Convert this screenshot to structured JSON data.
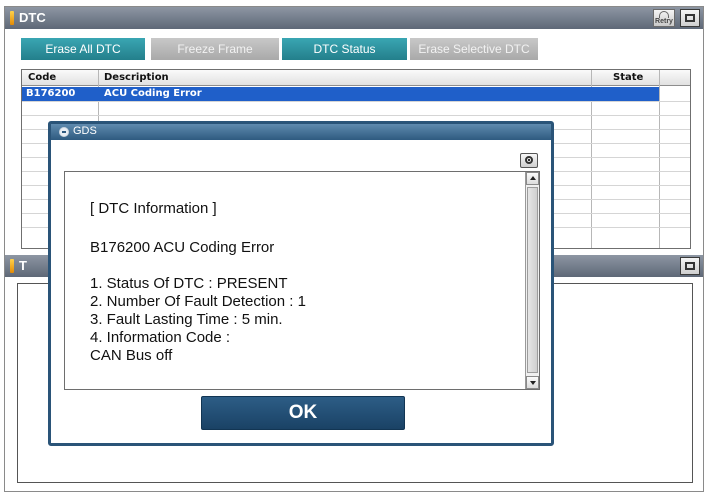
{
  "window": {
    "title": "DTC",
    "retry_label": "Retry"
  },
  "actions": [
    {
      "label": "Erase All DTC",
      "enabled": true
    },
    {
      "label": "Freeze Frame",
      "enabled": false
    },
    {
      "label": "DTC Status",
      "enabled": true
    },
    {
      "label": "Erase Selective DTC",
      "enabled": false
    }
  ],
  "table": {
    "headers": {
      "code": "Code",
      "description": "Description",
      "state": "State"
    },
    "rows": [
      {
        "code": "B176200",
        "description": "ACU Coding Error",
        "state": "",
        "selected": true
      }
    ]
  },
  "lower_panel": {
    "title_fragment": "T"
  },
  "dialog": {
    "title": "GDS",
    "heading": "[ DTC Information ]",
    "code_line": "B176200 ACU Coding Error",
    "items": [
      "1. Status Of DTC : PRESENT",
      "2. Number Of Fault Detection : 1",
      "3. Fault Lasting Time : 5 min.",
      "4. Information Code :",
      "CAN Bus off"
    ],
    "ok_label": "OK"
  },
  "colors": {
    "accent_teal": "#237f8b",
    "selection_blue": "#1f5fc9",
    "dialog_navy": "#2a5478",
    "title_marker": "#e38a06"
  },
  "icons": [
    "camera-icon",
    "restore-icon",
    "retry-icon",
    "scroll-up-icon",
    "scroll-down-icon"
  ]
}
